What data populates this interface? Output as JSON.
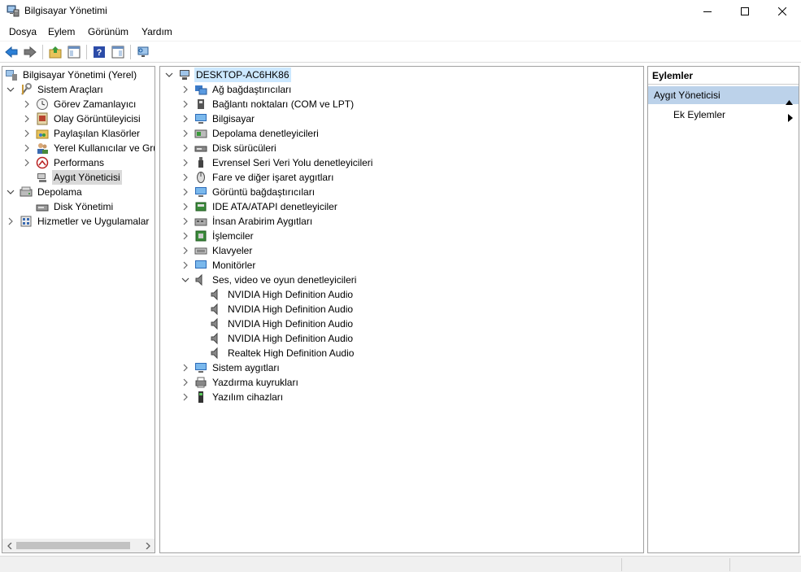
{
  "window": {
    "title": "Bilgisayar Yönetimi"
  },
  "menu": {
    "items": [
      "Dosya",
      "Eylem",
      "Görünüm",
      "Yardım"
    ]
  },
  "left_tree": {
    "root": "Bilgisayar Yönetimi (Yerel)",
    "system_tools": "Sistem Araçları",
    "task_scheduler": "Görev Zamanlayıcı",
    "event_viewer": "Olay Görüntüleyicisi",
    "shared_folders": "Paylaşılan Klasörler",
    "local_users": "Yerel Kullanıcılar ve Gru",
    "performance": "Performans",
    "device_manager": "Aygıt Yöneticisi",
    "storage": "Depolama",
    "disk_management": "Disk Yönetimi",
    "services": "Hizmetler ve Uygulamalar"
  },
  "device_tree": {
    "computer_name": "DESKTOP-AC6HK86",
    "categories": [
      "Ağ bağdaştırıcıları",
      "Bağlantı noktaları (COM ve LPT)",
      "Bilgisayar",
      "Depolama denetleyicileri",
      "Disk sürücüleri",
      "Evrensel Seri Veri Yolu denetleyicileri",
      "Fare ve diğer işaret aygıtları",
      "Görüntü bağdaştırıcıları",
      "IDE ATA/ATAPI denetleyiciler",
      "İnsan Arabirim Aygıtları",
      "İşlemciler",
      "Klavyeler",
      "Monitörler",
      "Ses, video ve oyun denetleyicileri"
    ],
    "audio_devices": [
      "NVIDIA High Definition Audio",
      "NVIDIA High Definition Audio",
      "NVIDIA High Definition Audio",
      "NVIDIA High Definition Audio",
      "Realtek High Definition Audio"
    ],
    "after_categories": [
      "Sistem aygıtları",
      "Yazdırma kuyrukları",
      "Yazılım cihazları"
    ]
  },
  "actions": {
    "header": "Eylemler",
    "section": "Aygıt Yöneticisi",
    "more_actions": "Ek Eylemler"
  },
  "colors": {
    "selection_blue": "#cce8ff",
    "selection_grey": "#d9d9d9",
    "actions_section": "#bcd2ea"
  }
}
